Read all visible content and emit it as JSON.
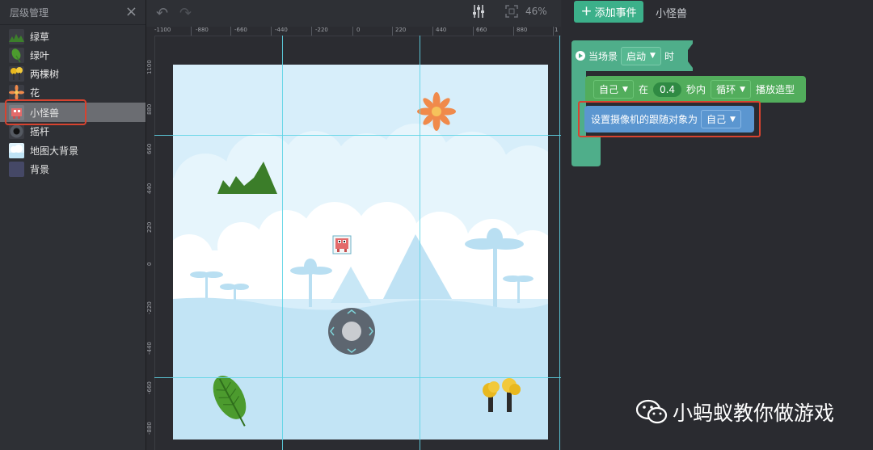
{
  "layer_panel": {
    "title": "层级管理",
    "items": [
      {
        "label": "绿草",
        "thumb": "grass-icon"
      },
      {
        "label": "绿叶",
        "thumb": "leaf-icon"
      },
      {
        "label": "两棵树",
        "thumb": "trees-icon"
      },
      {
        "label": "花",
        "thumb": "flower-icon"
      },
      {
        "label": "小怪兽",
        "thumb": "monster-icon",
        "selected": true
      },
      {
        "label": "摇杆",
        "thumb": "joystick-icon"
      },
      {
        "label": "地图大背景",
        "thumb": "map-background-icon"
      },
      {
        "label": "背景",
        "thumb": "background-icon"
      }
    ]
  },
  "canvas": {
    "zoom": "46%",
    "ruler_top": [
      "-1100",
      "-880",
      "-660",
      "-440",
      "-220",
      "0",
      "220",
      "440",
      "660",
      "880",
      "1"
    ],
    "ruler_left": [
      "1100",
      "880",
      "660",
      "440",
      "220",
      "0",
      "-220",
      "-440",
      "-660",
      "-880"
    ],
    "stage_background": "#d7eefa",
    "guide_color": "#5fd4e6"
  },
  "editor": {
    "add_event_label": "添加事件",
    "object_title": "小怪兽",
    "event_block": {
      "prefix": "当场景",
      "trigger": "启动",
      "suffix": "时"
    },
    "animation_block": {
      "target": "自己",
      "word_in": "在",
      "seconds": "0.4",
      "word_within": "秒内",
      "mode": "循环",
      "action": "播放造型"
    },
    "camera_block": {
      "label": "设置摄像机的跟随对象为",
      "target": "自己"
    },
    "colors": {
      "event_block": "#4fae8a",
      "action_block": "#52ad5c",
      "camera_block": "#5b96d0",
      "highlight": "#d8432f"
    }
  },
  "watermark": {
    "text": "小蚂蚁教你做游戏"
  }
}
